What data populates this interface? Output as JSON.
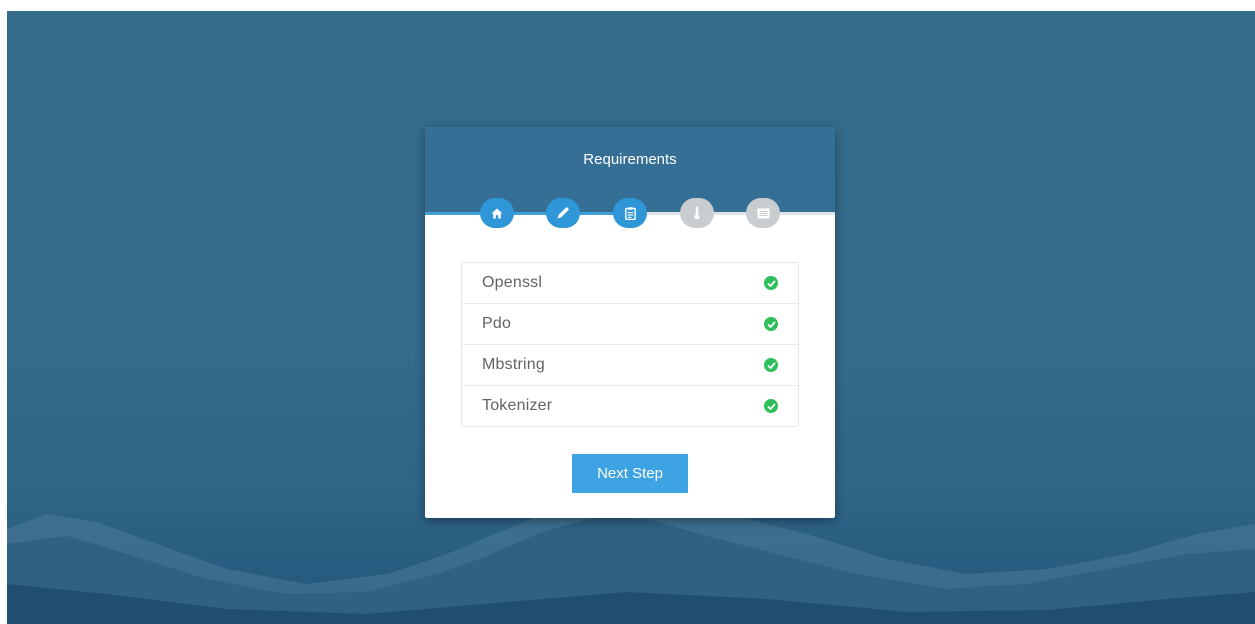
{
  "card": {
    "title": "Requirements",
    "steps": [
      {
        "icon": "home-icon",
        "status": "done"
      },
      {
        "icon": "pencil-icon",
        "status": "done"
      },
      {
        "icon": "clipboard-icon",
        "status": "done"
      },
      {
        "icon": "thermometer-icon",
        "status": "pending"
      },
      {
        "icon": "list-icon",
        "status": "pending"
      }
    ],
    "requirements": [
      {
        "name": "Openssl",
        "status": "ok"
      },
      {
        "name": "Pdo",
        "status": "ok"
      },
      {
        "name": "Mbstring",
        "status": "ok"
      },
      {
        "name": "Tokenizer",
        "status": "ok"
      }
    ],
    "next_label": "Next Step"
  },
  "colors": {
    "background": "#356b8c",
    "header": "#366f96",
    "step_done": "#2f96d8",
    "step_pending": "#c9cdd0",
    "check": "#2fbf5a",
    "button": "#3ea3e2"
  }
}
